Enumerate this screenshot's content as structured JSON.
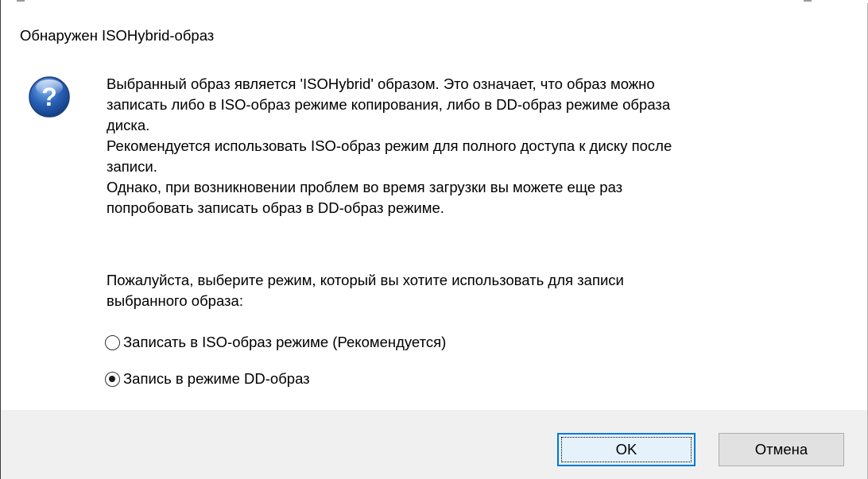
{
  "dialog": {
    "title": "Обнаружен ISOHybrid-образ",
    "icon": "question-icon",
    "message_lines": [
      "Выбранный образ является 'ISOHybrid' образом. Это означает, что образ можно",
      "записать либо в ISO-образ режиме копирования, либо в DD-образ режиме образа",
      "диска.",
      "Рекомендуется использовать ISO-образ режим для полного доступа к диску после",
      "записи.",
      "Однако, при возникновении проблем во время загрузки вы можете еще раз",
      "попробовать записать образ в DD-образ режиме."
    ],
    "question_lines": [
      "Пожалуйста, выберите режим, который вы хотите использовать для записи",
      "выбранного образа:"
    ],
    "options": [
      {
        "label": "Записать в ISO-образ режиме (Рекомендуется)",
        "selected": false
      },
      {
        "label": "Запись в режиме DD-образ",
        "selected": true
      }
    ],
    "buttons": {
      "ok": "OK",
      "cancel": "Отмена"
    }
  },
  "colors": {
    "icon_blue": "#2a62b8",
    "footer_bg": "#f0f0f0",
    "focus_border": "#0078d7"
  }
}
